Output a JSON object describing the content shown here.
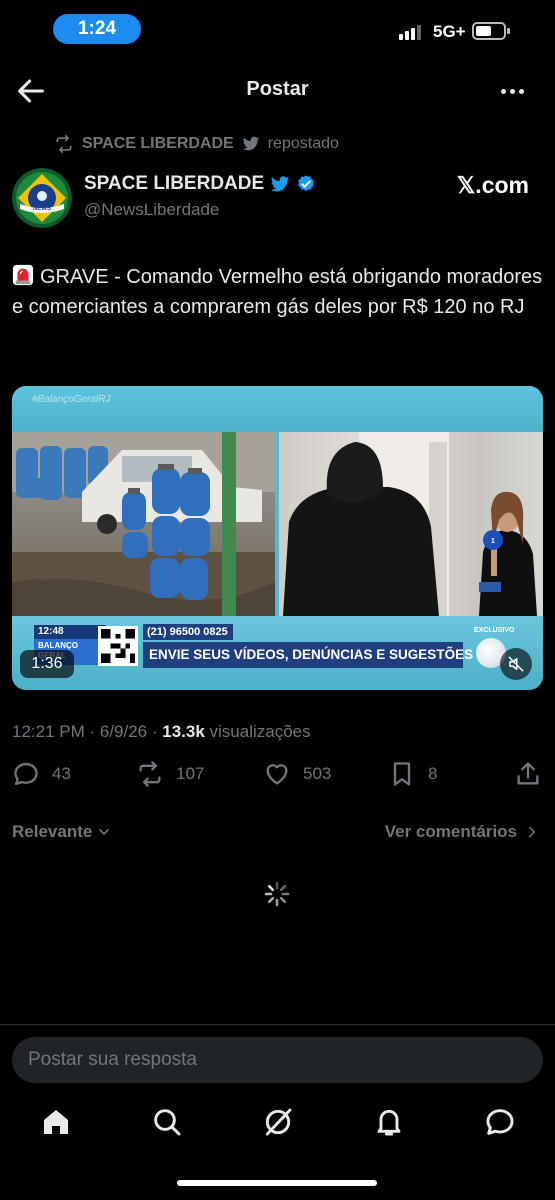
{
  "status_bar": {
    "time": "1:24",
    "network": "5G+"
  },
  "header": {
    "title": "Postar"
  },
  "repost": {
    "name": "SPACE LIBERDADE",
    "suffix": "repostado"
  },
  "author": {
    "name": "SPACE LIBERDADE",
    "handle": "@NewsLiberdade",
    "source_label": "𝕏.com",
    "avatar_text": "NEWS"
  },
  "tweet": {
    "text": "GRAVE - Comando Vermelho está obrigando moradores e comerciantes a comprarem gás deles por R$ 120 no RJ"
  },
  "media": {
    "hashtag": "#BalançoGeralRJ",
    "ticker_time": "12:48",
    "ticker_logo": "BALANÇO GERAL",
    "phone": "(21) 96500 0825",
    "cta": "ENVIE SEUS VÍDEOS, DENÚNCIAS E SUGESTÕES",
    "exclusive_label": "EXCLUSIVO",
    "duration": "1:36"
  },
  "meta": {
    "time": "12:21 PM · 6/9/26 · ",
    "views_count": "13.3k",
    "views_label": " visualizações"
  },
  "actions": {
    "replies": "43",
    "reposts": "107",
    "likes": "503",
    "bookmarks": "8"
  },
  "comments": {
    "sort_label": "Relevante",
    "view_label": "Ver comentários"
  },
  "reply": {
    "placeholder": "Postar sua resposta"
  },
  "colors": {
    "accent": "#1d8cf0",
    "background": "#000000",
    "muted": "#71767b",
    "text": "#e7e9ea"
  }
}
